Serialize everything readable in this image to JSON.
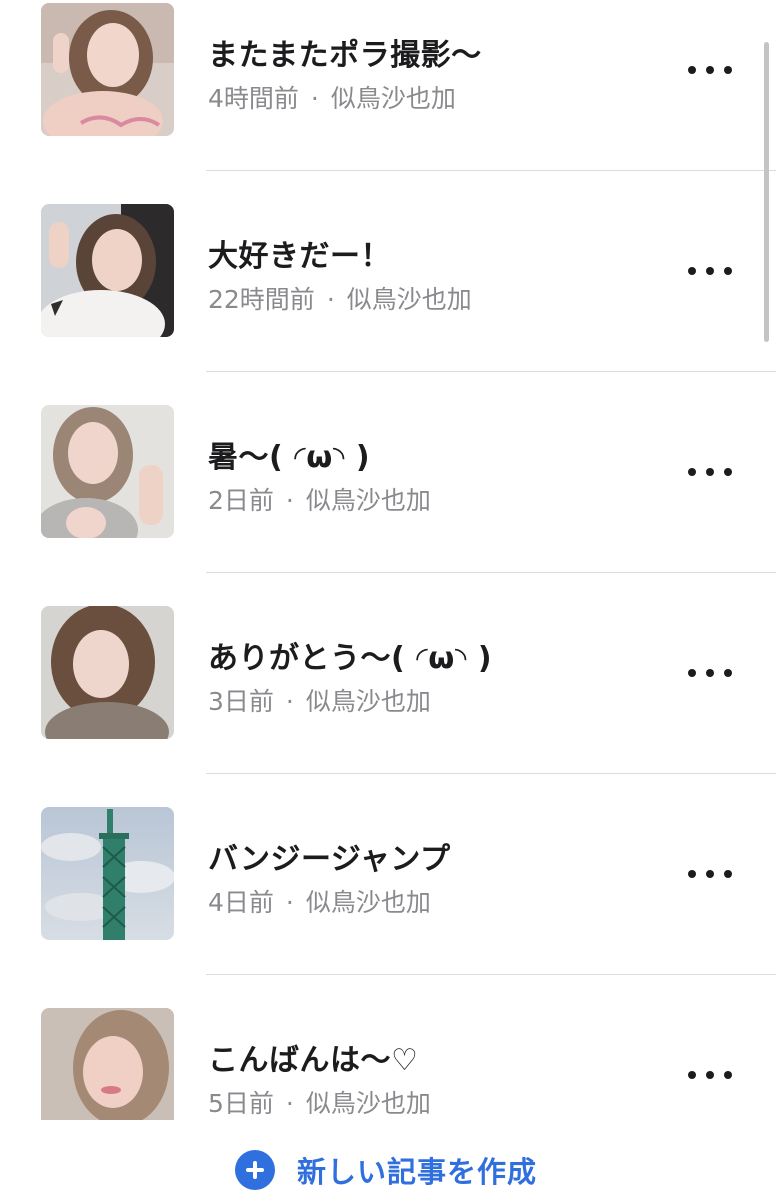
{
  "posts": [
    {
      "title": "またまたポラ撮影〜",
      "time": "4時間前",
      "author": "似鳥沙也加",
      "thumbnail": "selfie-photo"
    },
    {
      "title": "大好きだー！",
      "time": "22時間前",
      "author": "似鳥沙也加",
      "thumbnail": "selfie-photo"
    },
    {
      "title": "暑〜( ◜ω◝ )",
      "time": "2日前",
      "author": "似鳥沙也加",
      "thumbnail": "selfie-photo"
    },
    {
      "title": "ありがとう〜( ◜ω◝ )",
      "time": "3日前",
      "author": "似鳥沙也加",
      "thumbnail": "selfie-photo"
    },
    {
      "title": "バンジージャンプ",
      "time": "4日前",
      "author": "似鳥沙也加",
      "thumbnail": "tower-photo"
    },
    {
      "title": "こんばんは〜♡",
      "time": "5日前",
      "author": "似鳥沙也加",
      "thumbnail": "selfie-photo"
    }
  ],
  "meta_separator": "·",
  "more_icon": "more-horizontal-icon",
  "create_button": {
    "label": "新しい記事を作成",
    "icon": "plus-circle-icon"
  },
  "colors": {
    "accent": "#2f6fde",
    "title": "#1c1c1e",
    "meta": "#8a8a8e",
    "divider": "#dcdcde"
  }
}
